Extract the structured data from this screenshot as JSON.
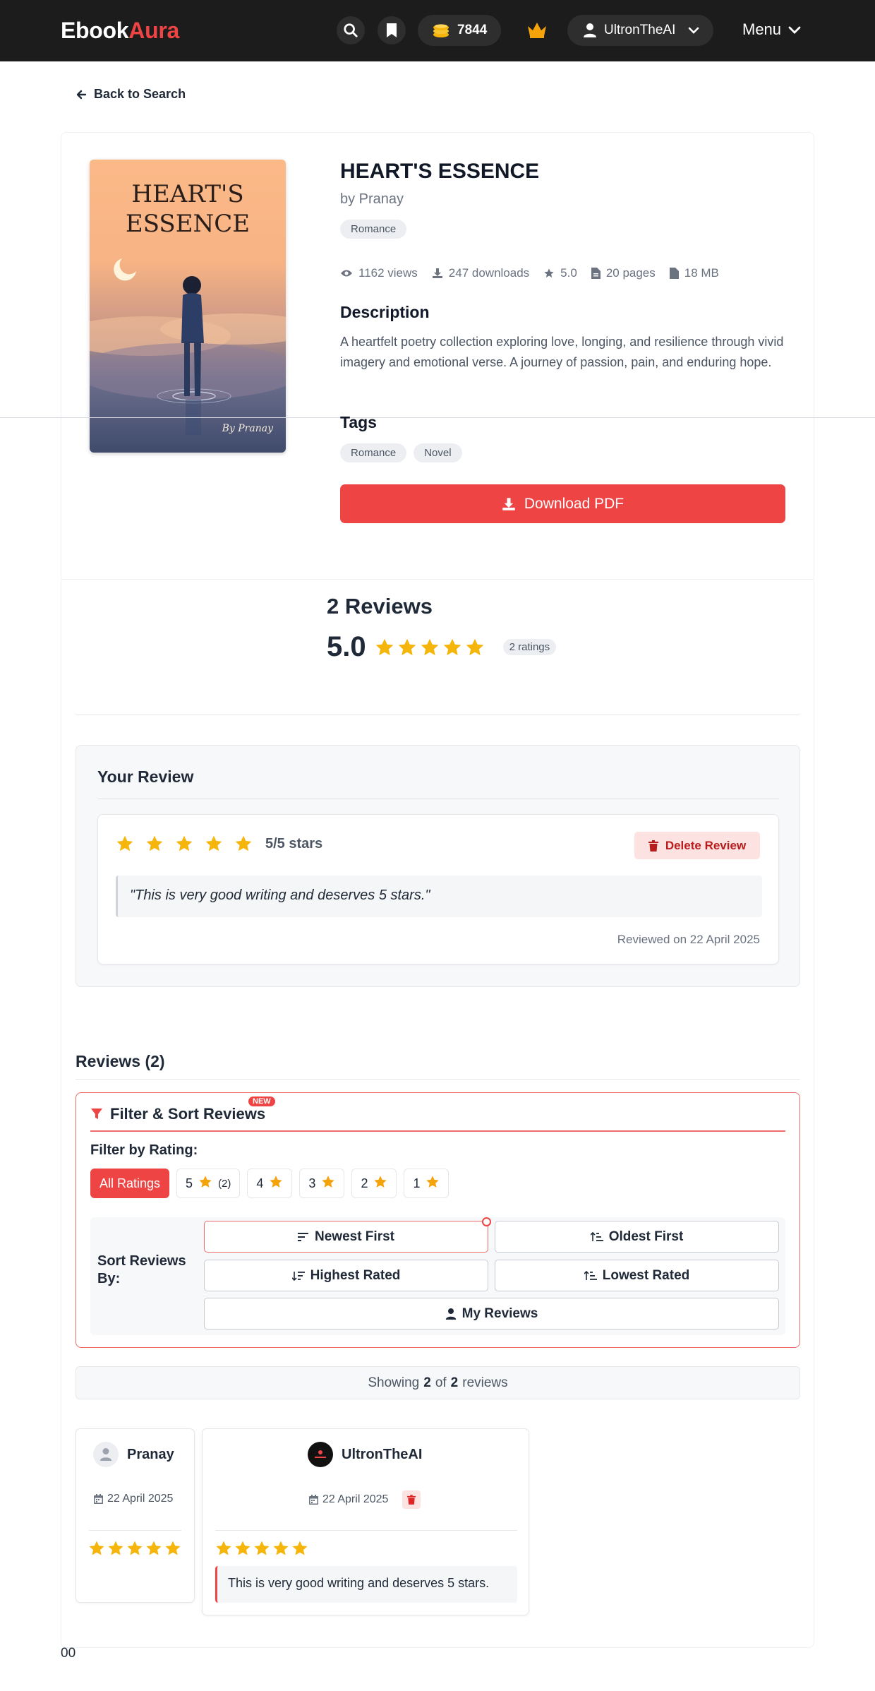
{
  "header": {
    "logo_main": "Ebook",
    "logo_accent": "Aura",
    "coins": "7844",
    "username": "UltronTheAI",
    "menu_label": "Menu"
  },
  "nav": {
    "back_label": "Back to Search"
  },
  "book": {
    "cover_title": "HEART'S ESSENCE",
    "cover_signature": "By Pranay",
    "title": "HEART'S ESSENCE",
    "author": "by Pranay",
    "genre": "Romance",
    "stats": {
      "views": "1162 views",
      "downloads": "247 downloads",
      "rating": "5.0",
      "pages": "20 pages",
      "size": "18 MB"
    },
    "description_heading": "Description",
    "description": "A heartfelt poetry collection exploring love, longing, and resilience through vivid imagery and emotional verse. A journey of passion, pain, and enduring hope.",
    "tags_heading": "Tags",
    "tags": [
      "Romance",
      "Novel"
    ],
    "download_label": "Download PDF"
  },
  "rating_summary": {
    "count_label": "2 Reviews",
    "average": "5.0",
    "ratings_chip": "2 ratings",
    "stars": 5
  },
  "your_review": {
    "heading": "Your Review",
    "stars": 5,
    "stars_label": "5/5 stars",
    "delete_label": "Delete Review",
    "text": "\"This is very good writing and deserves 5 stars.\"",
    "date": "Reviewed on 22 April 2025"
  },
  "reviews_section": {
    "heading": "Reviews (2)",
    "filter": {
      "title": "Filter & Sort Reviews",
      "badge": "NEW",
      "filter_label": "Filter by Rating:",
      "rating_buttons": [
        {
          "label": "All Ratings",
          "count": ""
        },
        {
          "label": "5",
          "count": "(2)"
        },
        {
          "label": "4",
          "count": ""
        },
        {
          "label": "3",
          "count": ""
        },
        {
          "label": "2",
          "count": ""
        },
        {
          "label": "1",
          "count": ""
        }
      ],
      "sort_label": "Sort Reviews By:",
      "sort_buttons": {
        "newest": "Newest First",
        "oldest": "Oldest First",
        "highest": "Highest Rated",
        "lowest": "Lowest Rated",
        "mine": "My Reviews"
      }
    },
    "showing": {
      "prefix": "Showing",
      "shown": "2",
      "of": "of",
      "total": "2",
      "suffix": "reviews"
    },
    "reviews": [
      {
        "user": "Pranay",
        "date": "22 April 2025",
        "stars": 5,
        "text": ""
      },
      {
        "user": "UltronTheAI",
        "date": "22 April 2025",
        "stars": 5,
        "text": "This is very good writing and deserves 5 stars."
      }
    ]
  },
  "footer": {
    "number": "00"
  },
  "colors": {
    "brand_red": "#ef4444",
    "star_gold": "#f5b50a",
    "header_bg": "#1c1c1c"
  }
}
